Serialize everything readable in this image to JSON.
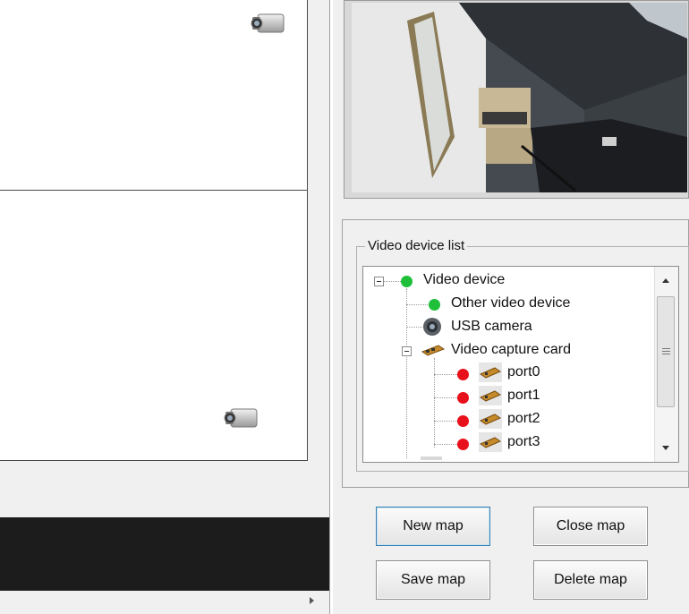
{
  "tree_panel": {
    "title": "Video device list",
    "nodes": [
      {
        "label": "Video device",
        "status": "online"
      },
      {
        "label": "Other video device",
        "status": "online"
      },
      {
        "label": "USB camera",
        "status": "camera"
      },
      {
        "label": "Video capture card",
        "status": "capture-card"
      },
      {
        "label": "port0",
        "status": "offline"
      },
      {
        "label": "port1",
        "status": "offline"
      },
      {
        "label": "port2",
        "status": "offline"
      },
      {
        "label": "port3",
        "status": "offline"
      }
    ]
  },
  "buttons": {
    "new_map": "New map",
    "close_map": "Close map",
    "save_map": "Save map",
    "delete_map": "Delete map"
  },
  "icons": {
    "camera": "camera-icon",
    "capture_card": "capture-card-icon",
    "usb_camera": "usb-camera-icon"
  },
  "colors": {
    "online": "#1fbf3a",
    "offline": "#e8101a",
    "dark_bar": "#1c1c1c"
  }
}
